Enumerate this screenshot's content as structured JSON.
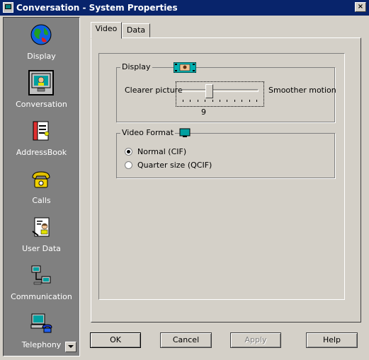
{
  "window": {
    "title": "Conversation - System Properties",
    "close_label": "×"
  },
  "sidebar": {
    "items": [
      {
        "label": "Display",
        "icon": "globe-icon"
      },
      {
        "label": "Conversation",
        "icon": "monitor-person-icon"
      },
      {
        "label": "AddressBook",
        "icon": "addressbook-icon"
      },
      {
        "label": "Calls",
        "icon": "telephone-icon"
      },
      {
        "label": "User Data",
        "icon": "user-document-icon"
      },
      {
        "label": "Communication",
        "icon": "network-icon"
      },
      {
        "label": "Telephony",
        "icon": "computer-phone-icon"
      }
    ],
    "selected": "Conversation"
  },
  "tabs": [
    {
      "label": "Video",
      "active": true
    },
    {
      "label": "Data",
      "active": false
    }
  ],
  "display_group": {
    "title": "Display",
    "left_label": "Clearer picture",
    "right_label": "Smoother motion",
    "slider_value": "9",
    "slider_fraction": 0.35
  },
  "video_format_group": {
    "title": "Video Format",
    "options": [
      {
        "label": "Normal (CIF)",
        "selected": true
      },
      {
        "label": "Quarter size (QCIF)",
        "selected": false
      }
    ]
  },
  "buttons": {
    "ok": "OK",
    "cancel": "Cancel",
    "apply": "Apply",
    "help": "Help"
  },
  "colors": {
    "titlebar": "#08246b",
    "sidebar": "#808080",
    "face": "#d4d0c8"
  }
}
